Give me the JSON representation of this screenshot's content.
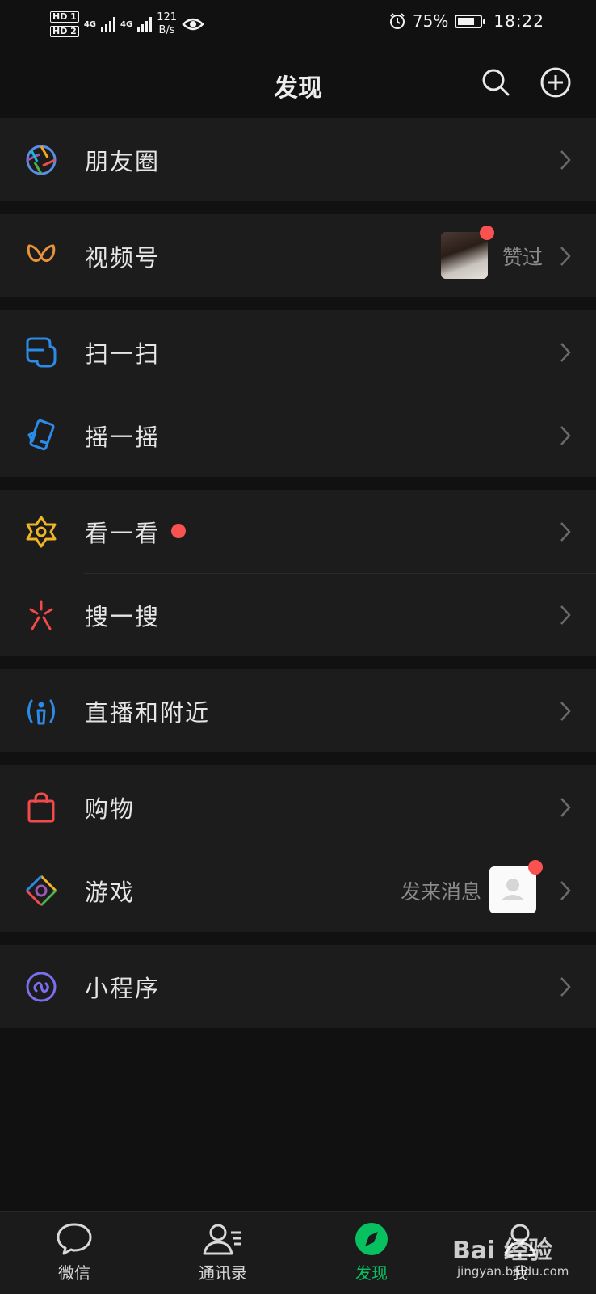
{
  "status": {
    "hd1": "HD 1",
    "hd2": "HD 2",
    "net1": "4G",
    "net2": "4G",
    "speed_value": "121",
    "speed_unit": "B/s",
    "battery_pct": "75%",
    "battery_level": 0.75,
    "time": "18:22"
  },
  "header": {
    "title": "发现"
  },
  "groups": [
    {
      "items": [
        {
          "label": "朋友圈"
        }
      ]
    },
    {
      "items": [
        {
          "label": "视频号",
          "side_text": "赞过"
        }
      ]
    },
    {
      "items": [
        {
          "label": "扫一扫"
        },
        {
          "label": "摇一摇"
        }
      ]
    },
    {
      "items": [
        {
          "label": "看一看"
        },
        {
          "label": "搜一搜"
        }
      ]
    },
    {
      "items": [
        {
          "label": "直播和附近"
        }
      ]
    },
    {
      "items": [
        {
          "label": "购物"
        },
        {
          "label": "游戏",
          "side_text": "发来消息"
        }
      ]
    },
    {
      "items": [
        {
          "label": "小程序"
        }
      ]
    }
  ],
  "tabs": [
    {
      "label": "微信"
    },
    {
      "label": "通讯录"
    },
    {
      "label": "发现"
    },
    {
      "label": "我"
    }
  ],
  "colors": {
    "accent": "#07c160",
    "badge": "#fa5151",
    "background": "#111111",
    "cell": "#1c1c1c"
  },
  "watermark": {
    "brand": "Bai 经验",
    "url": "jingyan.baidu.com"
  }
}
